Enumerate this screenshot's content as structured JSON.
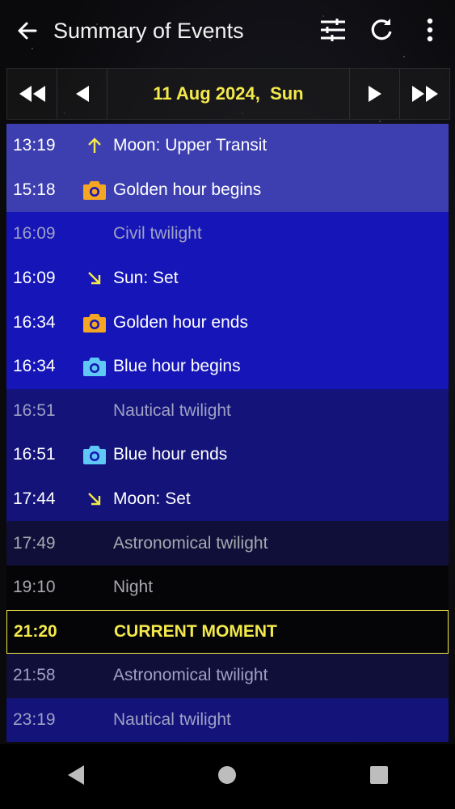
{
  "appbar": {
    "title": "Summary of Events"
  },
  "datebar": {
    "date": "11 Aug 2024,  Sun"
  },
  "events": [
    {
      "time": "13:19",
      "label": "Moon: Upper Transit",
      "icon": "arrow-up-icon",
      "style": "normal",
      "bg": "#3d3fb0"
    },
    {
      "time": "15:18",
      "label": "Golden hour begins",
      "icon": "camera-gold-icon",
      "style": "normal",
      "bg": "#3d3fb0"
    },
    {
      "time": "16:09",
      "label": "Civil twilight",
      "icon": "",
      "style": "dim",
      "bg": "#1616b8"
    },
    {
      "time": "16:09",
      "label": "Sun: Set",
      "icon": "arrow-down-right-icon",
      "style": "normal",
      "bg": "#1616b8"
    },
    {
      "time": "16:34",
      "label": "Golden hour ends",
      "icon": "camera-gold-icon",
      "style": "normal",
      "bg": "#1616b8"
    },
    {
      "time": "16:34",
      "label": "Blue hour begins",
      "icon": "camera-blue-icon",
      "style": "normal",
      "bg": "#1616b8"
    },
    {
      "time": "16:51",
      "label": "Nautical twilight",
      "icon": "",
      "style": "dim",
      "bg": "#13137a"
    },
    {
      "time": "16:51",
      "label": "Blue hour ends",
      "icon": "camera-blue-icon",
      "style": "normal",
      "bg": "#13137a"
    },
    {
      "time": "17:44",
      "label": "Moon: Set",
      "icon": "arrow-down-right-icon",
      "style": "normal",
      "bg": "#13137a"
    },
    {
      "time": "17:49",
      "label": "Astronomical twilight",
      "icon": "",
      "style": "dimgrey",
      "bg": "#0f0f3a"
    },
    {
      "time": "19:10",
      "label": "Night",
      "icon": "",
      "style": "dimgrey",
      "bg": "#050508"
    },
    {
      "time": "21:20",
      "label": "CURRENT MOMENT",
      "icon": "",
      "style": "current",
      "bg": "#050508"
    },
    {
      "time": "21:58",
      "label": "Astronomical twilight",
      "icon": "",
      "style": "dim",
      "bg": "#0f0f3a"
    },
    {
      "time": "23:19",
      "label": "Nautical twilight",
      "icon": "",
      "style": "dim",
      "bg": "#13137a"
    }
  ],
  "colors": {
    "accent": "#f3e94a",
    "gold": "#f5a623",
    "blue": "#5fc8f5"
  }
}
